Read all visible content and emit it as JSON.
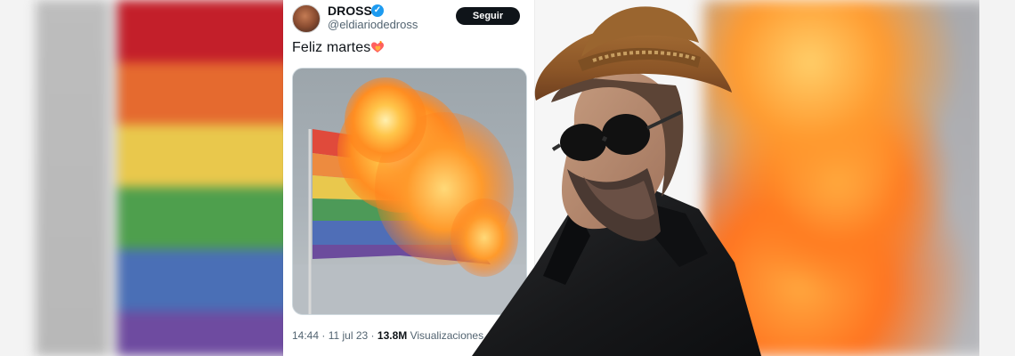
{
  "tweet": {
    "display_name": "DROSS",
    "handle": "@eldiariodedross",
    "follow_label": "Seguir",
    "text": "Feliz martes",
    "time": "14:44",
    "separator_1": "·",
    "date": "11 jul 23",
    "separator_2": "·",
    "views_count": "13.8M",
    "views_label": "Visualizaciones"
  },
  "colors": {
    "verified": "#1d9bf0",
    "follow_button": "#0f1419",
    "text_primary": "#0f1419",
    "text_secondary": "#536471"
  },
  "icons": {
    "verified": "verified-badge-icon",
    "heart": "fire-heart-icon"
  }
}
